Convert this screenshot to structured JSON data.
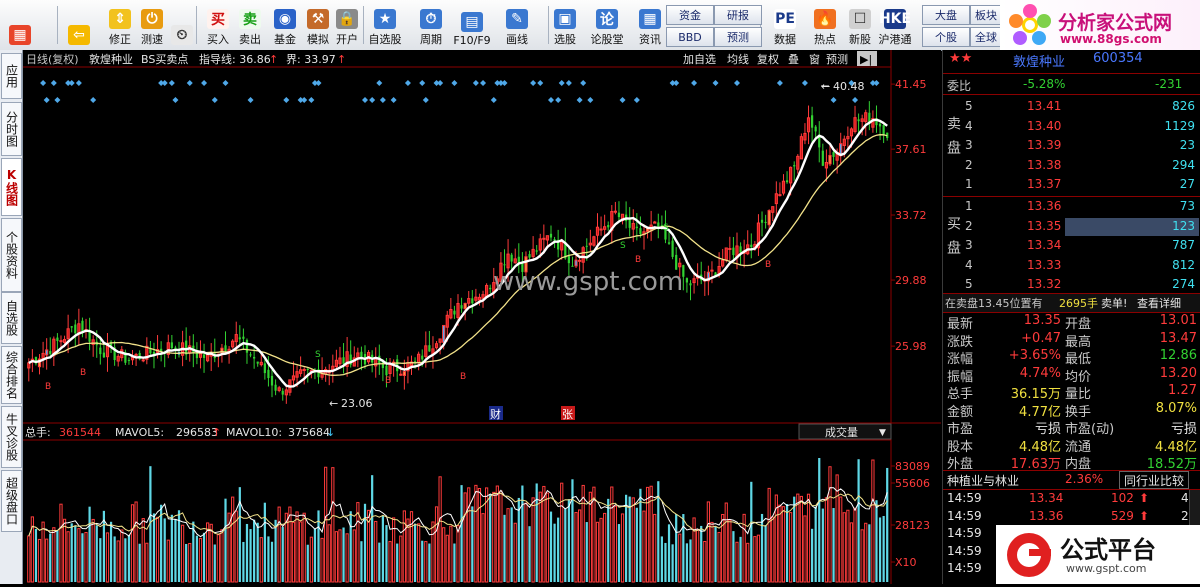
{
  "toolbar": {
    "items": [
      {
        "label": "",
        "icon": "grid-icon"
      },
      {
        "label": "",
        "icon": "back-arrow-icon"
      },
      {
        "label": "修正",
        "icon": "up-down-arrow-icon"
      },
      {
        "label": "测速",
        "icon": "power-icon"
      },
      {
        "label": "",
        "icon": "clock-icon"
      },
      {
        "label": "买入",
        "icon": "buy-icon",
        "glyph": "买"
      },
      {
        "label": "卖出",
        "icon": "sell-icon",
        "glyph": "卖"
      },
      {
        "label": "基金",
        "icon": "fund-icon"
      },
      {
        "label": "模拟",
        "icon": "hammer-icon"
      },
      {
        "label": "开户",
        "icon": "lock-icon"
      },
      {
        "label": "自选股",
        "icon": "star-folder-icon"
      },
      {
        "label": "周期",
        "icon": "period-clock-icon"
      },
      {
        "label": "F10/F9",
        "icon": "table-icon"
      },
      {
        "label": "画线",
        "icon": "pen-icon"
      },
      {
        "label": "选股",
        "icon": "select-stock-icon"
      },
      {
        "label": "论股堂",
        "icon": "forum-icon",
        "glyph": "论"
      },
      {
        "label": "资讯",
        "icon": "news-icon"
      },
      {
        "label": "数据",
        "icon": "pe-icon",
        "glyph": "PE"
      },
      {
        "label": "热点",
        "icon": "fire-icon"
      },
      {
        "label": "新股",
        "icon": "new-stock-icon"
      },
      {
        "label": "沪港通",
        "icon": "hk-icon",
        "glyph": "HKE"
      }
    ],
    "small_buttons": [
      {
        "label": "资金"
      },
      {
        "label": "研报"
      },
      {
        "label": "BBD"
      },
      {
        "label": "预测"
      },
      {
        "label": "大盘"
      },
      {
        "label": "板块"
      },
      {
        "label": "个股"
      },
      {
        "label": "全球"
      }
    ]
  },
  "logo": {
    "title": "分析家公式网",
    "url": "www.88gs.com"
  },
  "side_tabs": [
    "应用",
    "分时图",
    "K线图",
    "个股资料",
    "自选股",
    "综合排名",
    "牛叉诊股",
    "超级盘口"
  ],
  "kline": {
    "header_items": [
      "日线(复权)",
      "敦煌种业",
      "BS买卖点",
      "指导线: 36.86",
      "界: 33.97"
    ],
    "buttons": [
      "加自选",
      "均线",
      "复权",
      "叠",
      "窗",
      "预测"
    ],
    "price_axis": [
      "41.45",
      "37.61",
      "33.72",
      "29.88",
      "25.98"
    ],
    "high_label": "40.48",
    "low_label": "23.06",
    "watermark": "www.gspt.com",
    "markers": [
      "财",
      "张"
    ],
    "buy_label": "B",
    "sell_label": "S"
  },
  "volume": {
    "header": {
      "total_label": "总手:",
      "total": "361544",
      "mavol5_label": "MAVOL5:",
      "mavol5": "296583",
      "mavol10_label": "MAVOL10:",
      "mavol10": "375684"
    },
    "dropdown": "成交量",
    "axis": [
      "83089",
      "55606",
      "28123",
      "X10"
    ]
  },
  "quote": {
    "stock_title": "敦煌种业",
    "stock_code": "600354",
    "webi_label": "委比",
    "webi_pct": "-5.28%",
    "webi_diff": "-231",
    "sell_label": "卖盘",
    "buy_label": "买盘",
    "sell": [
      {
        "lvl": "5",
        "price": "13.41",
        "vol": "826"
      },
      {
        "lvl": "4",
        "price": "13.40",
        "vol": "1129"
      },
      {
        "lvl": "3",
        "price": "13.39",
        "vol": "23"
      },
      {
        "lvl": "2",
        "price": "13.38",
        "vol": "294"
      },
      {
        "lvl": "1",
        "price": "13.37",
        "vol": "27"
      }
    ],
    "buy": [
      {
        "lvl": "1",
        "price": "13.36",
        "vol": "73"
      },
      {
        "lvl": "2",
        "price": "13.35",
        "vol": "123"
      },
      {
        "lvl": "3",
        "price": "13.34",
        "vol": "787"
      },
      {
        "lvl": "4",
        "price": "13.33",
        "vol": "812"
      },
      {
        "lvl": "5",
        "price": "13.32",
        "vol": "274"
      }
    ],
    "notice": {
      "text": "在卖盘13.45位置有",
      "vol": "2695手",
      "tag": "卖单!",
      "link": "查看详细"
    },
    "stats": [
      [
        "最新",
        "13.35",
        "开盘",
        "13.01"
      ],
      [
        "涨跌",
        "+0.47",
        "最高",
        "13.47"
      ],
      [
        "涨幅",
        "+3.65%",
        "最低",
        "12.86"
      ],
      [
        "振幅",
        "4.74%",
        "均价",
        "13.20"
      ],
      [
        "总手",
        "36.15万",
        "量比",
        "1.27"
      ],
      [
        "金额",
        "4.77亿",
        "换手",
        "8.07%"
      ],
      [
        "市盈",
        "亏损",
        "市盈(动)",
        "亏损"
      ],
      [
        "股本",
        "4.48亿",
        "流通",
        "4.48亿"
      ],
      [
        "外盘",
        "17.63万",
        "内盘",
        "18.52万"
      ]
    ],
    "industry": {
      "name": "种植业与林业",
      "pct": "2.36%",
      "compare": "同行业比较"
    },
    "ticks": [
      {
        "time": "14:59",
        "price": "13.34",
        "vol": "102",
        "n": "4"
      },
      {
        "time": "14:59",
        "price": "13.36",
        "vol": "529",
        "n": "2"
      },
      {
        "time": "14:59",
        "price": "",
        "vol": "",
        "n": ""
      },
      {
        "time": "14:59",
        "price": "",
        "vol": "",
        "n": ""
      },
      {
        "time": "14:59",
        "price": "",
        "vol": "",
        "n": ""
      }
    ]
  },
  "platform_logo": {
    "title": "公式平台",
    "url": "www.gspt.com"
  },
  "colors": {
    "up": "#ff3b3b",
    "down": "#32d232",
    "ma_short": "#ffffff",
    "ma_long": "#f2e28a",
    "volume_up": "#ff3b3b",
    "volume_down": "#5fd8e6"
  }
}
